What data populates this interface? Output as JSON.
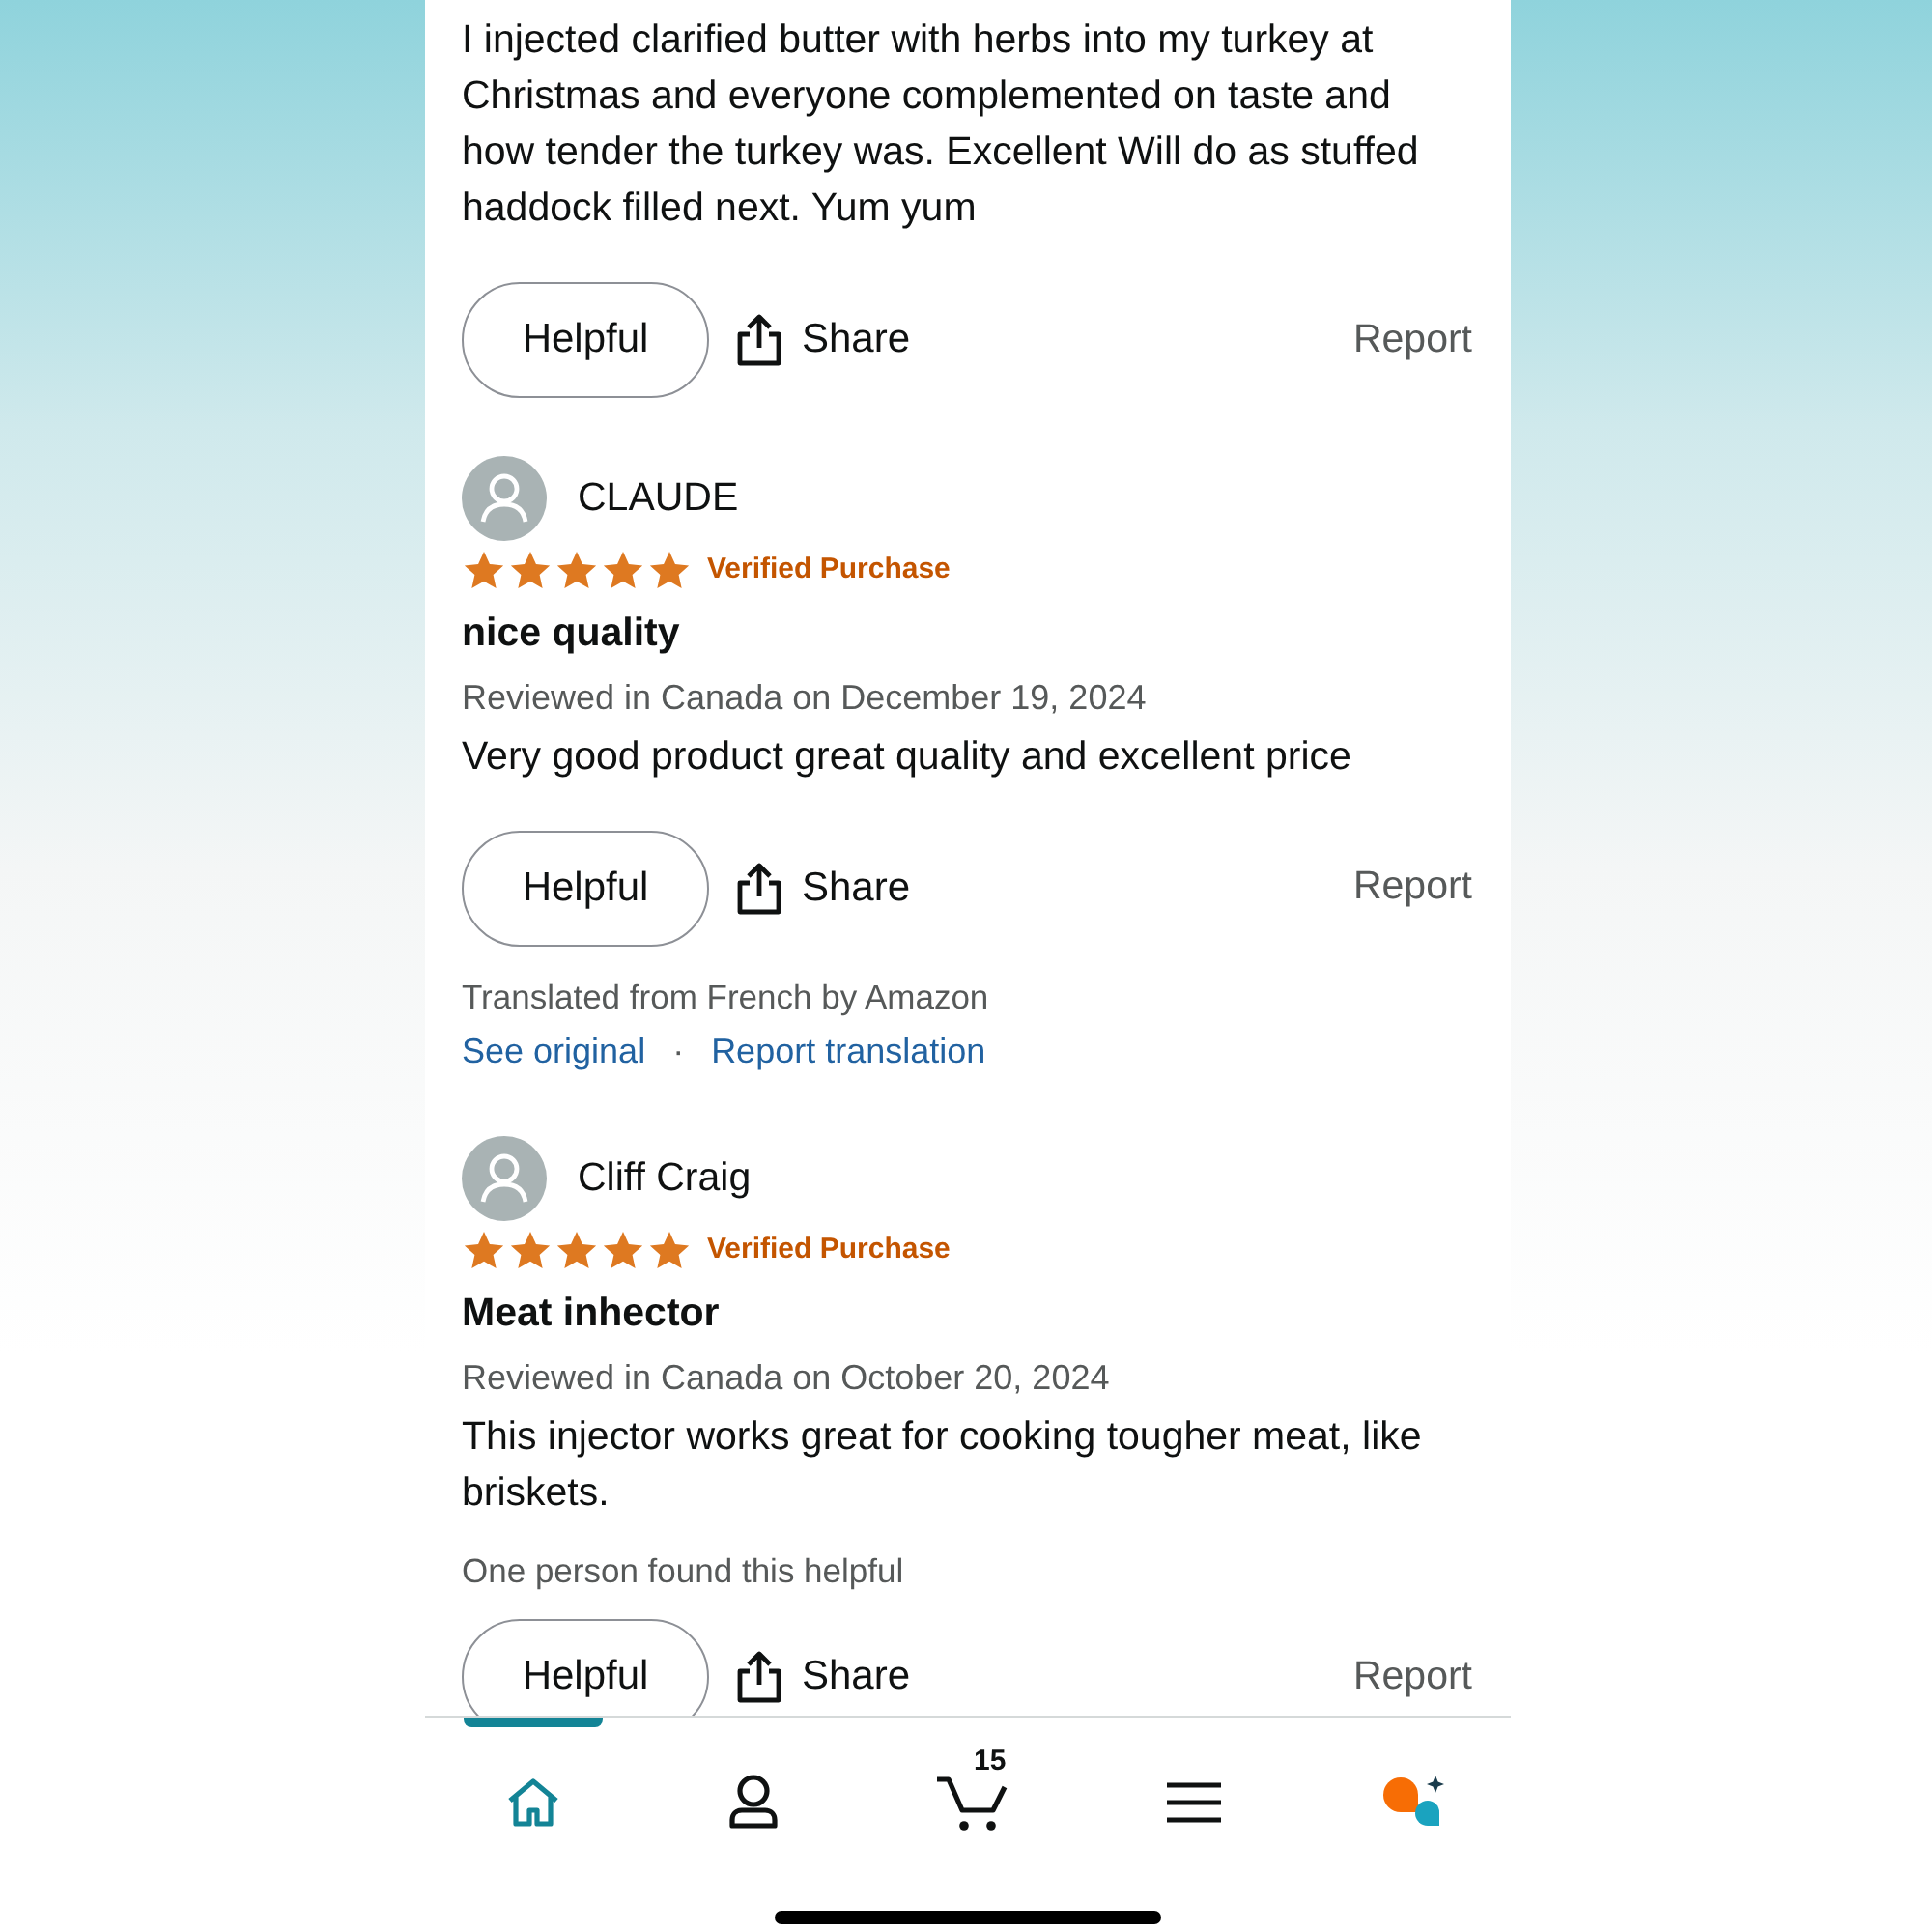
{
  "reviews": [
    {
      "body": "I injected clarified butter with herbs into my turkey at Christmas and everyone complemented on taste and how tender the turkey was. Excellent Will do as stuffed haddock filled next. Yum yum",
      "actions": {
        "helpful": "Helpful",
        "share": "Share",
        "report": "Report"
      }
    },
    {
      "author": "CLAUDE",
      "stars": 5,
      "badge": "Verified Purchase",
      "title": "nice quality",
      "meta": "Reviewed in Canada on December 19, 2024",
      "body": "Very good product great quality and excellent price",
      "actions": {
        "helpful": "Helpful",
        "share": "Share",
        "report": "Report"
      },
      "translation": {
        "note": "Translated from French by Amazon",
        "links": [
          "See original",
          "Report translation"
        ],
        "separator": "·"
      }
    },
    {
      "author": "Cliff Craig",
      "stars": 5,
      "badge": "Verified Purchase",
      "title": "Meat inhector",
      "meta": "Reviewed in Canada on October 20, 2024",
      "body": "This injector works great for cooking tougher meat, like briskets.",
      "helpful_note": "One person found this helpful",
      "actions": {
        "helpful": "Helpful",
        "share": "Share",
        "report": "Report"
      }
    }
  ],
  "nav": [
    {
      "kind": "home",
      "selected": true
    },
    {
      "kind": "account",
      "selected": false
    },
    {
      "kind": "cart",
      "selected": false,
      "count": "15"
    },
    {
      "kind": "menu",
      "selected": false
    },
    {
      "kind": "assistant",
      "selected": false
    }
  ]
}
